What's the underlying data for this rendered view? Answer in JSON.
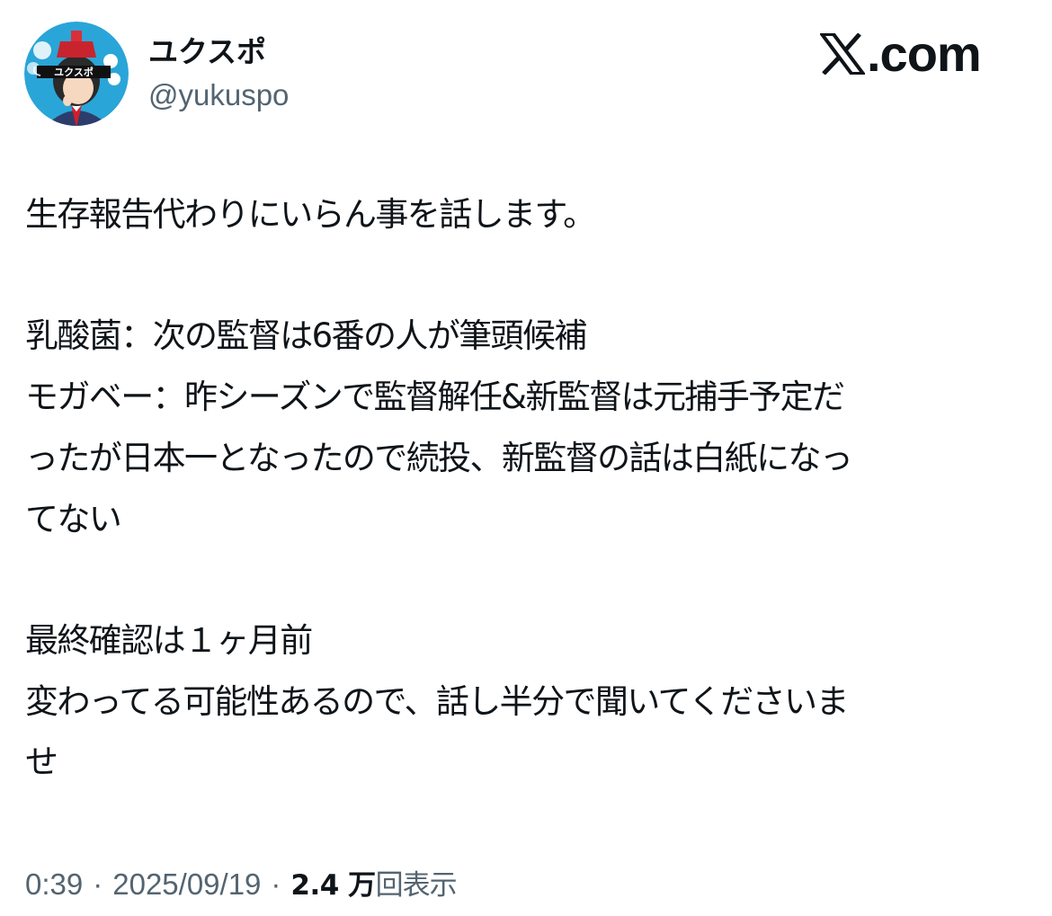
{
  "author": {
    "display_name": "ユクスポ",
    "handle": "@yukuspo",
    "avatar_text": "ユクスポ"
  },
  "brand": {
    "logo_icon": "x-logo-icon",
    "suffix": ".com"
  },
  "tweet": {
    "lines": [
      "生存報告代わりにいらん事を話します。",
      "",
      "乳酸菌：次の監督は6番の人が筆頭候補",
      "モガベー：昨シーズンで監督解任&新監督は元捕手予定だ",
      "ったが日本一となったので続投、新監督の話は白紙になっ",
      "てない",
      "",
      "最終確認は１ヶ月前",
      "変わってる可能性あるので、話し半分で聞いてくださいま",
      "せ"
    ]
  },
  "meta": {
    "time": "0:39",
    "separator": "·",
    "date": "2025/09/19",
    "views_count": "2.4 万",
    "views_label": "回表示"
  },
  "colors": {
    "text_primary": "#0f1419",
    "text_secondary": "#536471",
    "avatar_bg": "#2aa5d8"
  }
}
